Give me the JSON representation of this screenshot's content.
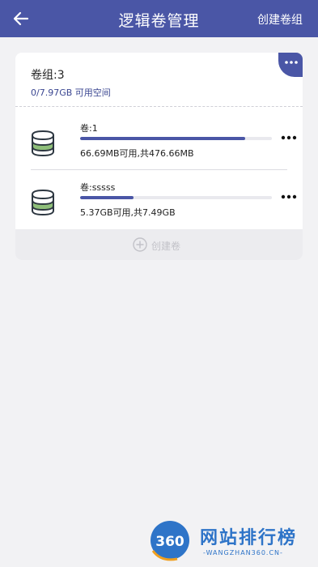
{
  "header": {
    "title": "逻辑卷管理",
    "action_label": "创建卷组"
  },
  "group": {
    "name": "卷组:3",
    "space": "0/7.97GB 可用空间"
  },
  "volumes": [
    {
      "name": "卷:1",
      "size_text": "66.69MB可用,共476.66MB",
      "used_fraction": 0.86
    },
    {
      "name": "卷:sssss",
      "size_text": "5.37GB可用,共7.49GB",
      "used_fraction": 0.28
    }
  ],
  "create_volume": {
    "label": "创建卷"
  },
  "watermark": {
    "badge": "360",
    "title": "网站排行榜",
    "subtitle": "-WANGZHAN360.CN-"
  },
  "colors": {
    "primary": "#4a56a6",
    "background": "#f2f2f4",
    "disk_green": "#8fbf7a"
  }
}
